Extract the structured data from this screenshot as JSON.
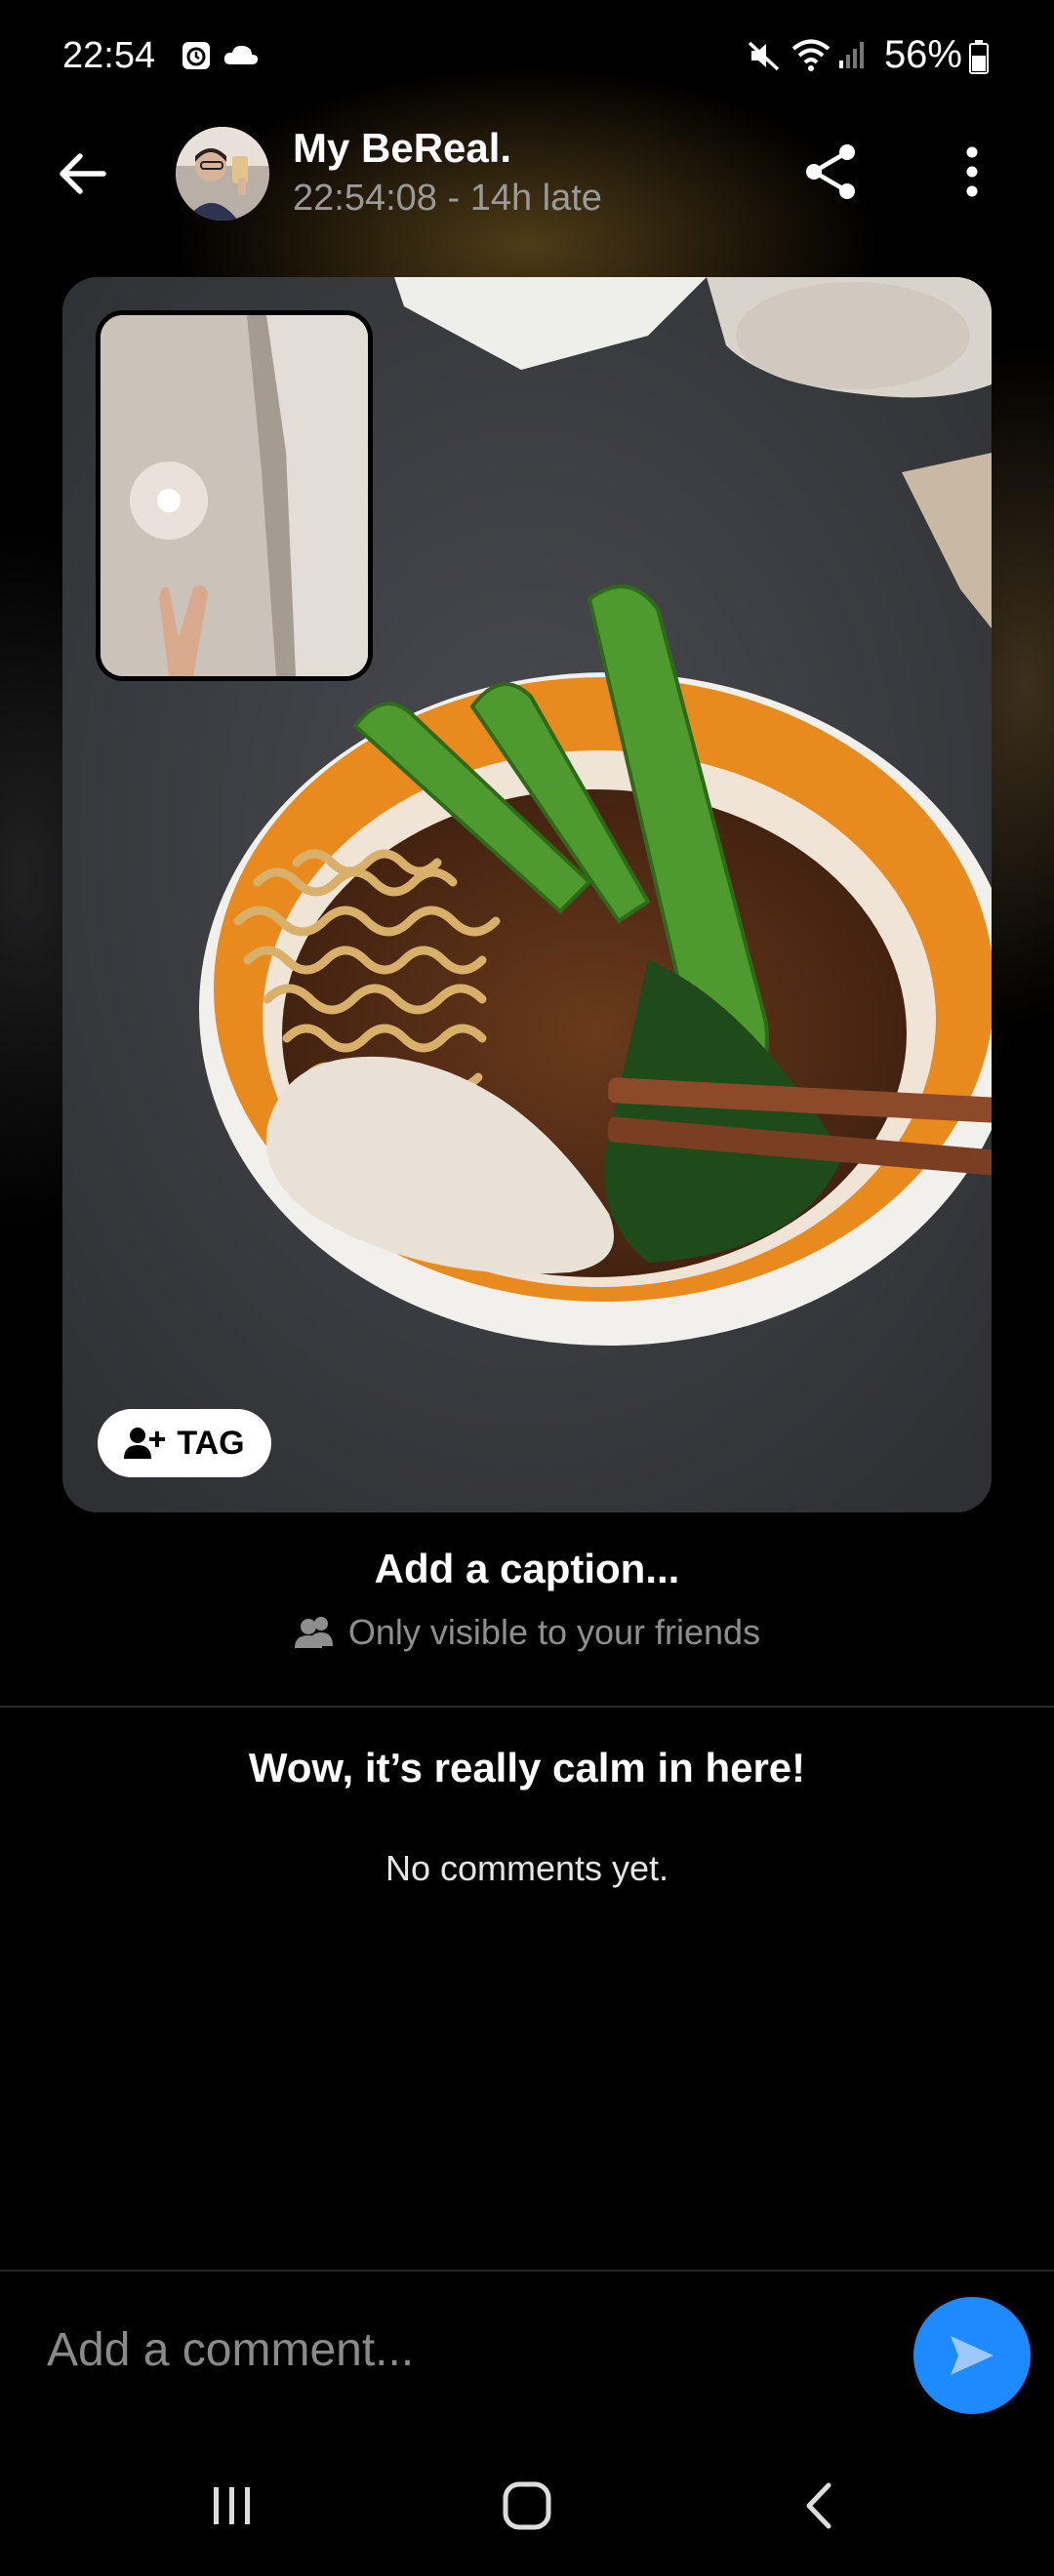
{
  "status_bar": {
    "time": "22:54",
    "battery": "56%"
  },
  "header": {
    "title": "My BeReal.",
    "subtitle": "22:54:08 - 14h late"
  },
  "photo": {
    "tag_label": "TAG"
  },
  "caption": {
    "placeholder": "Add a caption...",
    "visibility": "Only visible to your friends"
  },
  "comments": {
    "empty_title": "Wow, it’s really calm in here!",
    "empty_subtitle": "No comments yet."
  },
  "comment_bar": {
    "placeholder": "Add a comment..."
  },
  "colors": {
    "accent": "#1d8bff",
    "background": "#000000",
    "muted_text": "#8e8e8e"
  },
  "icons": [
    "back-arrow-icon",
    "share-icon",
    "more-vertical-icon",
    "add-person-icon",
    "friends-icon",
    "send-icon",
    "recent-apps-icon",
    "home-icon",
    "nav-back-icon"
  ]
}
